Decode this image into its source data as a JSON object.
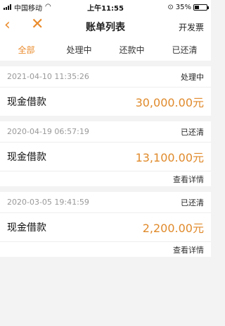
{
  "status_bar": {
    "carrier": "中国移动",
    "time": "上午11:55",
    "battery": "35%"
  },
  "nav": {
    "back_icon": "chevron-left-icon",
    "close_icon": "close-icon",
    "title": "账单列表",
    "invoice_label": "开发票"
  },
  "tabs": [
    {
      "label": "全部",
      "active": true
    },
    {
      "label": "处理中",
      "active": false
    },
    {
      "label": "还款中",
      "active": false
    },
    {
      "label": "已还清",
      "active": false
    }
  ],
  "bills": [
    {
      "date": "2021-04-10 11:35:26",
      "status": "处理中",
      "title": "现金借款",
      "amount": "30,000.00元"
    },
    {
      "date": "2020-04-19 06:57:19",
      "status": "已还清",
      "title": "现金借款",
      "amount": "13,100.00元",
      "detail_label": "查看详情"
    },
    {
      "date": "2020-03-05 19:41:59",
      "status": "已还清",
      "title": "现金借款",
      "amount": "2,200.00元",
      "detail_label": "查看详情"
    }
  ],
  "colors": {
    "accent": "#ea8b2c",
    "amount": "#e08a2b"
  }
}
